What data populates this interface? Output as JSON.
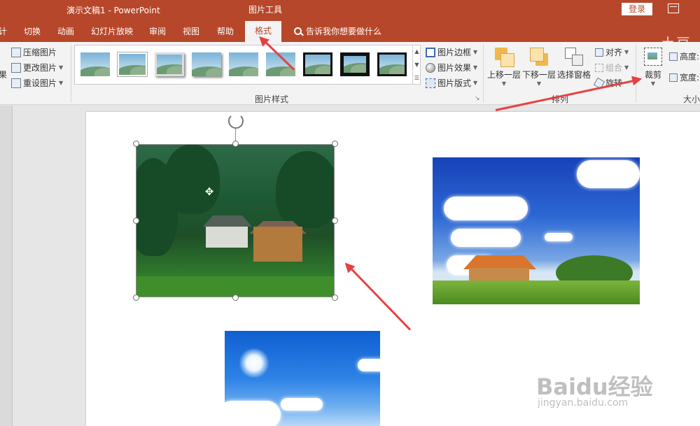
{
  "titlebar": {
    "doc_title": "演示文稿1  -  PowerPoint",
    "context_tab_group": "图片工具",
    "login_label": "登录"
  },
  "tabs": [
    {
      "label": "计"
    },
    {
      "label": "切换"
    },
    {
      "label": "动画"
    },
    {
      "label": "幻灯片放映"
    },
    {
      "label": "审阅"
    },
    {
      "label": "视图"
    },
    {
      "label": "帮助"
    },
    {
      "label": "格式",
      "active": true
    }
  ],
  "tell_me": {
    "placeholder": "告诉我你想要做什么"
  },
  "brand_text": "土豆覃",
  "ribbon": {
    "adjust": {
      "effects_partial": "果",
      "compress": "压缩图片",
      "change": "更改图片",
      "reset": "重设图片"
    },
    "picture_styles": {
      "label": "图片样式",
      "border": "图片边框",
      "effects": "图片效果",
      "layout": "图片版式"
    },
    "arrange": {
      "label": "排列",
      "bring_forward": "上移一层",
      "send_backward": "下移一层",
      "selection_pane": "选择窗格",
      "align": "对齐",
      "group": "组合",
      "rotate": "旋转"
    },
    "size": {
      "crop": "裁剪",
      "height": "高度:",
      "width": "宽度:",
      "label": "大小"
    }
  },
  "watermark": {
    "brand": "Baidu经验",
    "url": "jingyan.baidu.com"
  },
  "colors": {
    "accent": "#b7472a",
    "arrow": "#e84040"
  }
}
